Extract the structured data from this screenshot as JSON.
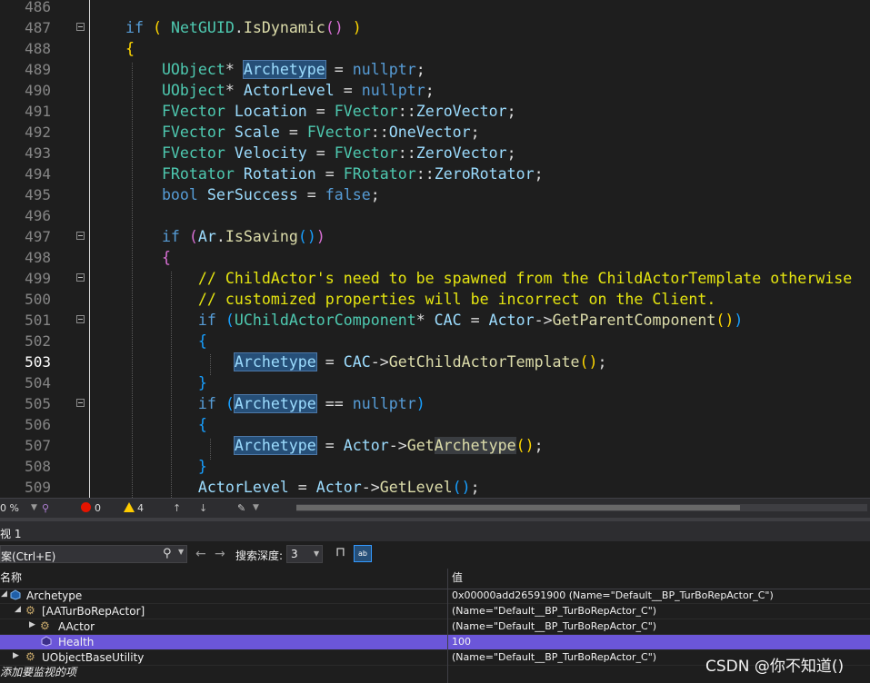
{
  "editor": {
    "lines": [
      {
        "n": "486",
        "fold": false
      },
      {
        "n": "487",
        "fold": true
      },
      {
        "n": "488",
        "fold": false
      },
      {
        "n": "489",
        "fold": false
      },
      {
        "n": "490",
        "fold": false
      },
      {
        "n": "491",
        "fold": false
      },
      {
        "n": "492",
        "fold": false
      },
      {
        "n": "493",
        "fold": false
      },
      {
        "n": "494",
        "fold": false
      },
      {
        "n": "495",
        "fold": false
      },
      {
        "n": "496",
        "fold": false
      },
      {
        "n": "497",
        "fold": true
      },
      {
        "n": "498",
        "fold": false
      },
      {
        "n": "499",
        "fold": true
      },
      {
        "n": "500",
        "fold": false
      },
      {
        "n": "501",
        "fold": true
      },
      {
        "n": "502",
        "fold": false
      },
      {
        "n": "503",
        "fold": false,
        "current": true
      },
      {
        "n": "504",
        "fold": false
      },
      {
        "n": "505",
        "fold": true
      },
      {
        "n": "506",
        "fold": false
      },
      {
        "n": "507",
        "fold": false
      },
      {
        "n": "508",
        "fold": false
      },
      {
        "n": "509",
        "fold": false
      }
    ]
  },
  "status": {
    "zoom": "0 %",
    "errors": "0",
    "warnings": "4"
  },
  "watch": {
    "title": "视 1",
    "search_placeholder": "案(Ctrl+E)",
    "search_depth_label": "搜索深度:",
    "search_depth_value": "3",
    "col_name": "名称",
    "col_value": "值",
    "rows": [
      {
        "name": "Archetype",
        "value": "0x00000add26591900 (Name=\"Default__BP_TurBoRepActor_C\")"
      },
      {
        "name": "[AATurBoRepActor]",
        "value": "(Name=\"Default__BP_TurBoRepActor_C\")"
      },
      {
        "name": "AActor",
        "value": "(Name=\"Default__BP_TurBoRepActor_C\")"
      },
      {
        "name": "Health",
        "value": "100"
      },
      {
        "name": "UObjectBaseUtility",
        "value": "(Name=\"Default__BP_TurBoRepActor_C\")"
      }
    ],
    "add_item": "添加要监视的项"
  },
  "watermark": "CSDN @你不知道()",
  "colors": {
    "type": "#4ec9b0",
    "keyword": "#569cd6",
    "variable": "#9cdcfe",
    "function": "#dcdcaa",
    "comment": "#e5e510",
    "selected_row": "#6b56d8"
  }
}
